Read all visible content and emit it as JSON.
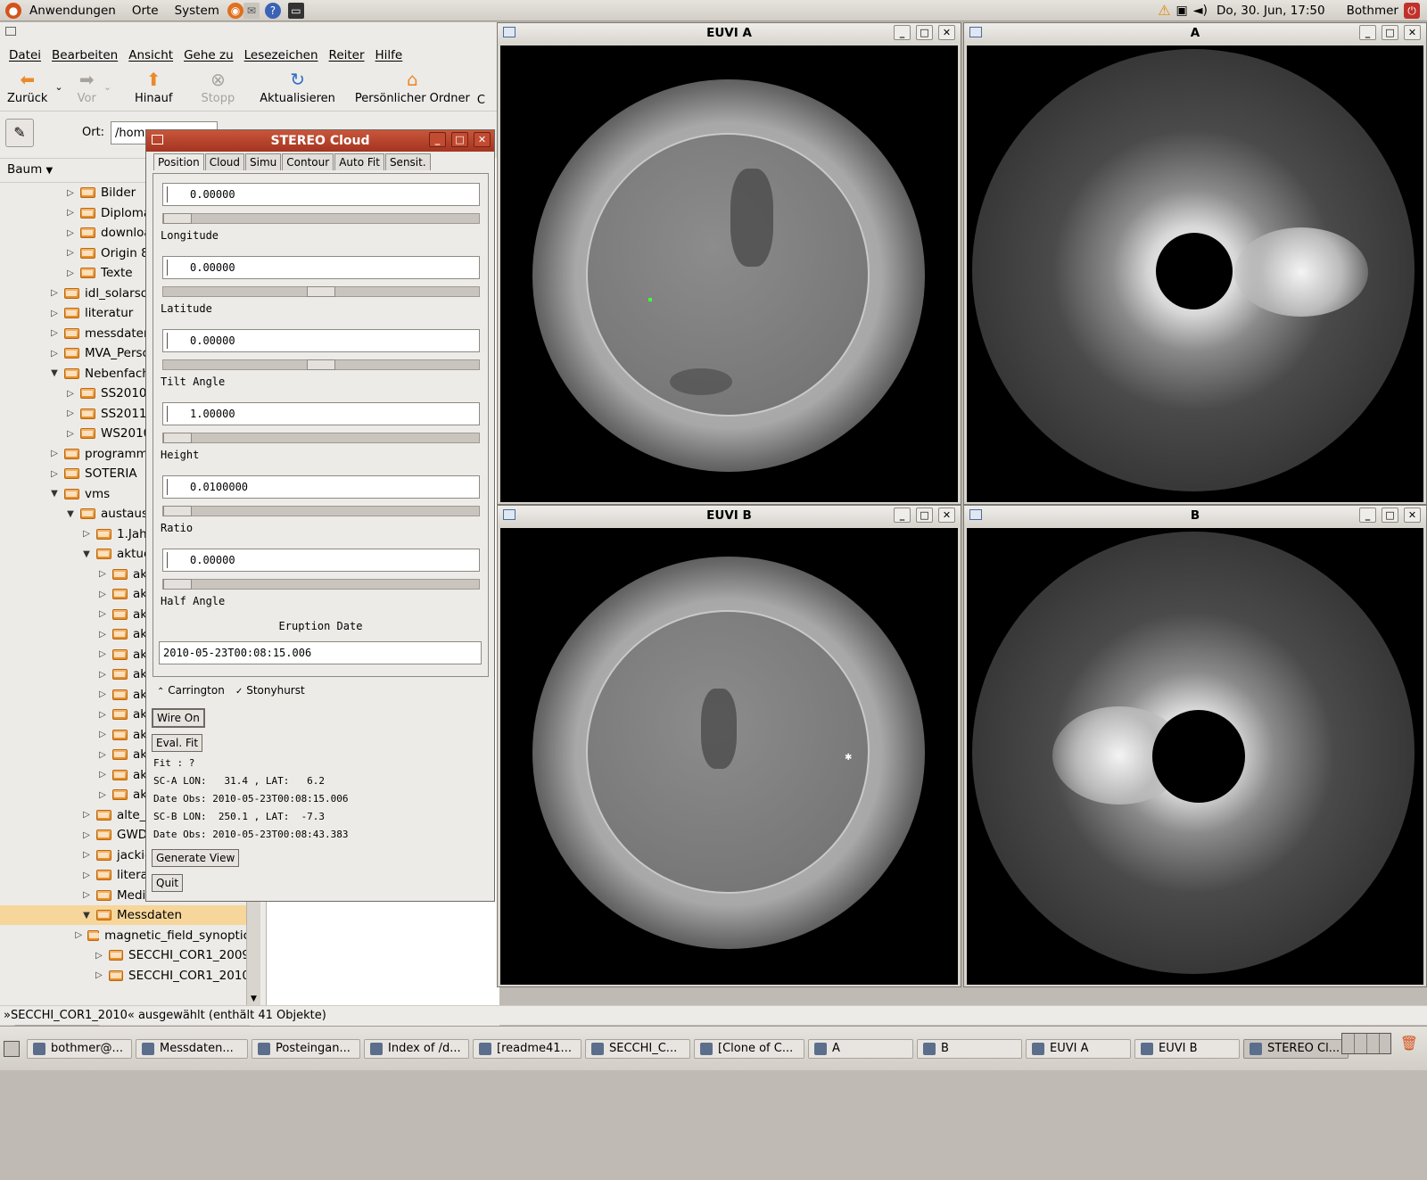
{
  "top_panel": {
    "menus": [
      "Anwendungen",
      "Orte",
      "System"
    ],
    "datetime": "Do, 30. Jun, 17:50",
    "user": "Bothmer"
  },
  "file_manager": {
    "menu": [
      "Datei",
      "Bearbeiten",
      "Ansicht",
      "Gehe zu",
      "Lesezeichen",
      "Reiter",
      "Hilfe"
    ],
    "toolbar": {
      "back": "Zurück",
      "forward": "Vor",
      "up": "Hinauf",
      "stop": "Stopp",
      "reload": "Aktualisieren",
      "home": "Persönlicher Ordner",
      "extra": "C"
    },
    "location_label": "Ort:",
    "location_value": "/hom",
    "side_pane_label": "Baum",
    "status": "»SECCHI_COR1_2010« ausgewählt (enthält 41 Objekte)",
    "tree": [
      {
        "label": "Bilder",
        "level": 2,
        "expanded": false
      },
      {
        "label": "Diplomarbe",
        "level": 2,
        "expanded": false
      },
      {
        "label": "download",
        "level": 2,
        "expanded": false
      },
      {
        "label": "Origin 8.5",
        "level": 2,
        "expanded": false
      },
      {
        "label": "Texte",
        "level": 2,
        "expanded": false
      },
      {
        "label": "idl_solarsoft",
        "level": 1,
        "expanded": false
      },
      {
        "label": "literatur",
        "level": 1,
        "expanded": false
      },
      {
        "label": "messdaten",
        "level": 1,
        "expanded": false
      },
      {
        "label": "MVA_Perschke",
        "level": 1,
        "expanded": false
      },
      {
        "label": "Nebenfachpra",
        "level": 1,
        "expanded": true
      },
      {
        "label": "SS2010",
        "level": 2,
        "expanded": false
      },
      {
        "label": "SS2011",
        "level": 2,
        "expanded": false
      },
      {
        "label": "WS2010-11",
        "level": 2,
        "expanded": false
      },
      {
        "label": "programme",
        "level": 1,
        "expanded": false
      },
      {
        "label": "SOTERIA",
        "level": 1,
        "expanded": false
      },
      {
        "label": "vms",
        "level": 1,
        "expanded": true
      },
      {
        "label": "austausch",
        "level": 2,
        "expanded": true
      },
      {
        "label": "1.Jahres",
        "level": 3,
        "expanded": false
      },
      {
        "label": "aktuelle_",
        "level": 3,
        "expanded": true
      },
      {
        "label": "aktue",
        "level": 4,
        "expanded": false
      },
      {
        "label": "aktue",
        "level": 4,
        "expanded": false
      },
      {
        "label": "aktue",
        "level": 4,
        "expanded": false
      },
      {
        "label": "aktue",
        "level": 4,
        "expanded": false
      },
      {
        "label": "aktue",
        "level": 4,
        "expanded": false
      },
      {
        "label": "aktue",
        "level": 4,
        "expanded": false
      },
      {
        "label": "aktue",
        "level": 4,
        "expanded": false
      },
      {
        "label": "aktue",
        "level": 4,
        "expanded": false
      },
      {
        "label": "aktue",
        "level": 4,
        "expanded": false
      },
      {
        "label": "aktue",
        "level": 4,
        "expanded": false
      },
      {
        "label": "aktue",
        "level": 4,
        "expanded": false
      },
      {
        "label": "aktue",
        "level": 4,
        "expanded": false
      },
      {
        "label": "alte_erg",
        "level": 3,
        "expanded": false
      },
      {
        "label": "GWDG_c",
        "level": 3,
        "expanded": false
      },
      {
        "label": "jackie_e",
        "level": 3,
        "expanded": false
      },
      {
        "label": "literatur",
        "level": 3,
        "expanded": false
      },
      {
        "label": "Media_Bothmer",
        "level": 3,
        "expanded": false
      },
      {
        "label": "Messdaten",
        "level": 3,
        "expanded": true,
        "selected": true
      },
      {
        "label": "magnetic_field_synoptic",
        "level": 4,
        "expanded": false
      },
      {
        "label": "SECCHI_COR1_2009",
        "level": 4,
        "expanded": false
      },
      {
        "label": "SECCHI_COR1_2010",
        "level": 4,
        "expanded": false
      }
    ]
  },
  "windows": {
    "euvi_a": "EUVI A",
    "cor_a": "A",
    "euvi_b": "EUVI B",
    "cor_b": "B"
  },
  "stereo_cloud": {
    "title": "STEREO Cloud",
    "tabs": [
      "Position",
      "Cloud",
      "Simu",
      "Contour",
      "Auto Fit",
      "Sensit."
    ],
    "params": [
      {
        "label": "Longitude",
        "value": "0.00000",
        "slider": 0.0
      },
      {
        "label": "Latitude",
        "value": "0.00000",
        "slider": 0.5
      },
      {
        "label": "Tilt Angle",
        "value": "0.00000",
        "slider": 0.5
      },
      {
        "label": "Height",
        "value": "1.00000",
        "slider": 0.0
      },
      {
        "label": "Ratio",
        "value": "0.0100000",
        "slider": 0.0
      },
      {
        "label": "Half Angle",
        "value": "0.00000",
        "slider": 0.0
      }
    ],
    "eruption_date_label": "Eruption Date",
    "eruption_date": "2010-05-23T00:08:15.006",
    "radio_carrington": "Carrington",
    "radio_stonyhurst": "Stonyhurst",
    "wire_button": "Wire On",
    "eval_button": "Eval. Fit",
    "fit_text": "Fit : ?",
    "sca_line": "SC-A LON:   31.4 , LAT:   6.2",
    "sca_date": "Date Obs: 2010-05-23T00:08:15.006",
    "scb_line": "SC-B LON:  250.1 , LAT:  -7.3",
    "scb_date": "Date Obs: 2010-05-23T00:08:43.383",
    "generate_button": "Generate View",
    "quit_button": "Quit"
  },
  "taskbar": [
    "bothmer@...",
    "Messdaten...",
    "Posteingan...",
    "Index of /d...",
    "[readme41...",
    "SECCHI_C...",
    "[Clone of C...",
    "A",
    "B",
    "EUVI A",
    "EUVI B",
    "STEREO Cl..."
  ]
}
